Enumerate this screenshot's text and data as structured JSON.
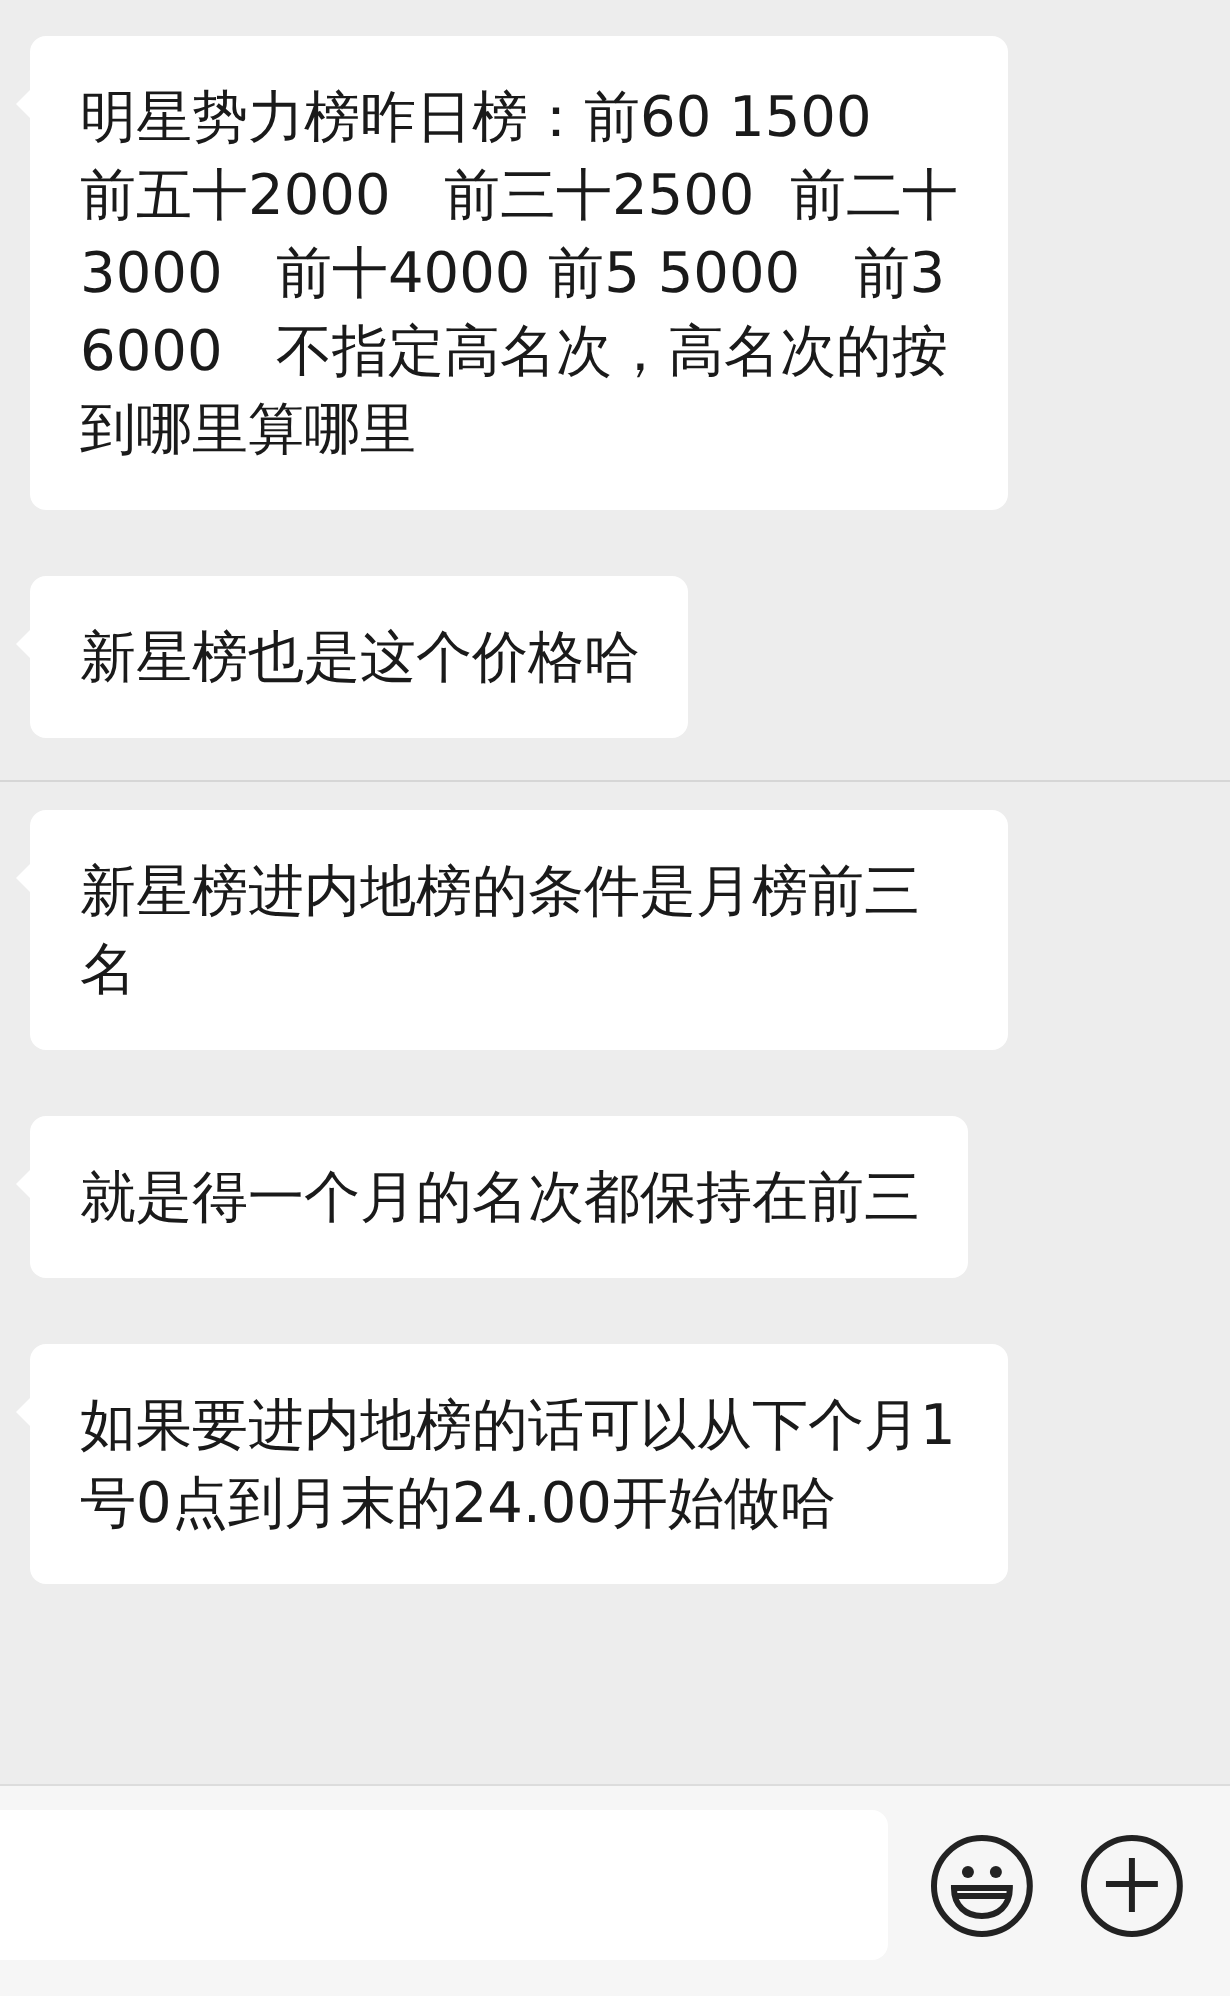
{
  "messages": [
    {
      "text": "明星势力榜昨日榜：前60 1500   前五十2000   前三十2500  前二十3000   前十4000 前5 5000   前3  6000   不指定高名次，高名次的按到哪里算哪里",
      "divider_after": false
    },
    {
      "text": "新星榜也是这个价格哈",
      "divider_after": true
    },
    {
      "text": "新星榜进内地榜的条件是月榜前三名",
      "divider_after": false
    },
    {
      "text": "就是得一个月的名次都保持在前三",
      "divider_after": false
    },
    {
      "text": "如果要进内地榜的话可以从下个月1号0点到月末的24.00开始做哈",
      "divider_after": false
    }
  ]
}
